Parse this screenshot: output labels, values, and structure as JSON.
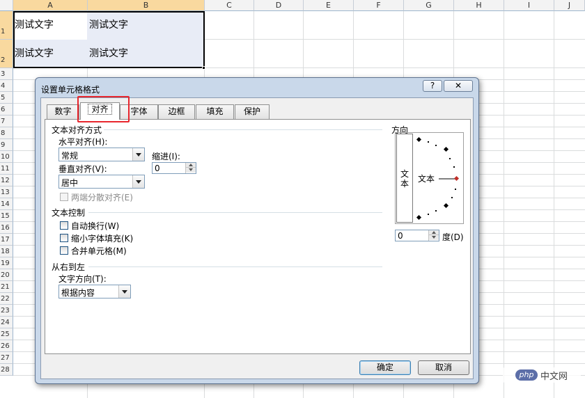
{
  "spreadsheet": {
    "columns": [
      "A",
      "B",
      "C",
      "D",
      "E",
      "F",
      "G",
      "H",
      "I",
      "J"
    ],
    "rows": [
      "1",
      "2",
      "3",
      "4",
      "5",
      "6",
      "7",
      "8",
      "9",
      "10",
      "11",
      "12",
      "13",
      "14",
      "15",
      "16",
      "17",
      "18",
      "19",
      "20",
      "21",
      "22",
      "23",
      "24",
      "25",
      "26",
      "27",
      "28"
    ],
    "cells": {
      "a1": "测试文字",
      "b1": "测试文字",
      "a2": "测试文字",
      "b2": "测试文字"
    }
  },
  "dialog": {
    "title": "设置单元格格式",
    "help_label": "?",
    "close_label": "✕",
    "tabs": [
      {
        "label": "数字"
      },
      {
        "label": "对齐"
      },
      {
        "label": "字体"
      },
      {
        "label": "边框"
      },
      {
        "label": "填充"
      },
      {
        "label": "保护"
      }
    ],
    "active_tab": "对齐",
    "text_alignment": {
      "group_label": "文本对齐方式",
      "horizontal_label": "水平对齐(H):",
      "horizontal_value": "常规",
      "indent_label": "缩进(I):",
      "indent_value": "0",
      "vertical_label": "垂直对齐(V):",
      "vertical_value": "居中",
      "distributed_label": "两端分散对齐(E)"
    },
    "text_control": {
      "group_label": "文本控制",
      "wrap_label": "自动换行(W)",
      "shrink_label": "缩小字体填充(K)",
      "merge_label": "合并单元格(M)"
    },
    "rtl": {
      "group_label": "从右到左",
      "direction_label": "文字方向(T):",
      "direction_value": "根据内容"
    },
    "orientation": {
      "group_label": "方向",
      "vertical_text": "文本",
      "dial_text": "文本",
      "degrees_value": "0",
      "degrees_label": "度(D)"
    },
    "ok_label": "确定",
    "cancel_label": "取消"
  },
  "watermark": {
    "logo": "php",
    "text": "中文网"
  },
  "colors": {
    "highlight": "#e8262d",
    "selected_header": "#f9d99f",
    "selection_fill": "#e8ecf6",
    "dialog_frame": "#c9d8ea"
  }
}
